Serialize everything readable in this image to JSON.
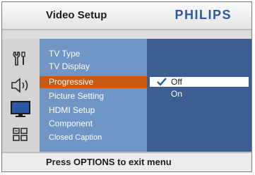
{
  "header": {
    "title": "Video Setup",
    "brand": "PHILIPS"
  },
  "icons": [
    "settings-icon",
    "audio-speaker-icon",
    "tv-monitor-icon",
    "grid-preference-icon"
  ],
  "menu": {
    "items": [
      {
        "label": "TV Type"
      },
      {
        "label": "TV Display"
      },
      {
        "label": "Progressive",
        "selected": true
      },
      {
        "label": "Picture Setting"
      },
      {
        "label": "HDMI Setup"
      },
      {
        "label": "Component"
      },
      {
        "label": "Closed Caption"
      }
    ]
  },
  "submenu": {
    "options": [
      {
        "label": "Off",
        "selected": true
      },
      {
        "label": "On"
      }
    ]
  },
  "footer": {
    "hint": "Press OPTIONS to exit menu"
  },
  "colors": {
    "menu_bg": "#6f95c4",
    "submenu_bg": "#3d5f8f",
    "highlight": "#c85a14",
    "brand": "#2a5aa6"
  }
}
